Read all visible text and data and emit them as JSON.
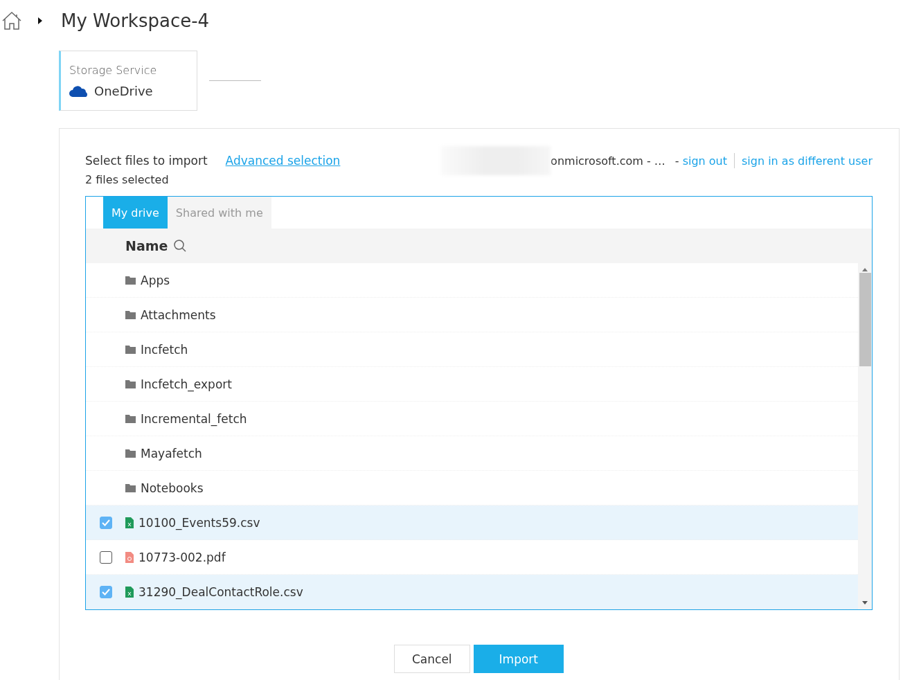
{
  "breadcrumb": {
    "title": "My Workspace-4"
  },
  "storage_card": {
    "label": "Storage Service",
    "service": "OneDrive"
  },
  "import_panel": {
    "heading": "Select files to import",
    "advanced_link": "Advanced selection",
    "selection_count": "2 files selected",
    "account": {
      "email_suffix": "onmicrosoft.com - …",
      "separator": "-",
      "sign_out": "sign out",
      "switch_user": "sign in as different user"
    }
  },
  "tabs": [
    {
      "label": "My drive",
      "selected": true
    },
    {
      "label": "Shared with me",
      "selected": false
    }
  ],
  "table": {
    "column": "Name",
    "rows": [
      {
        "kind": "folder",
        "name": "Apps"
      },
      {
        "kind": "folder",
        "name": "Attachments"
      },
      {
        "kind": "folder",
        "name": "Incfetch"
      },
      {
        "kind": "folder",
        "name": "Incfetch_export"
      },
      {
        "kind": "folder",
        "name": "Incremental_fetch"
      },
      {
        "kind": "folder",
        "name": "Mayafetch"
      },
      {
        "kind": "folder",
        "name": "Notebooks"
      },
      {
        "kind": "csv",
        "name": "10100_Events59.csv",
        "checked": true
      },
      {
        "kind": "pdf",
        "name": "10773-002.pdf",
        "checked": false
      },
      {
        "kind": "csv",
        "name": "31290_DealContactRole.csv",
        "checked": true
      }
    ]
  },
  "buttons": [
    {
      "kind": "secondary",
      "label": "Cancel"
    },
    {
      "kind": "primary",
      "label": "Import"
    }
  ]
}
